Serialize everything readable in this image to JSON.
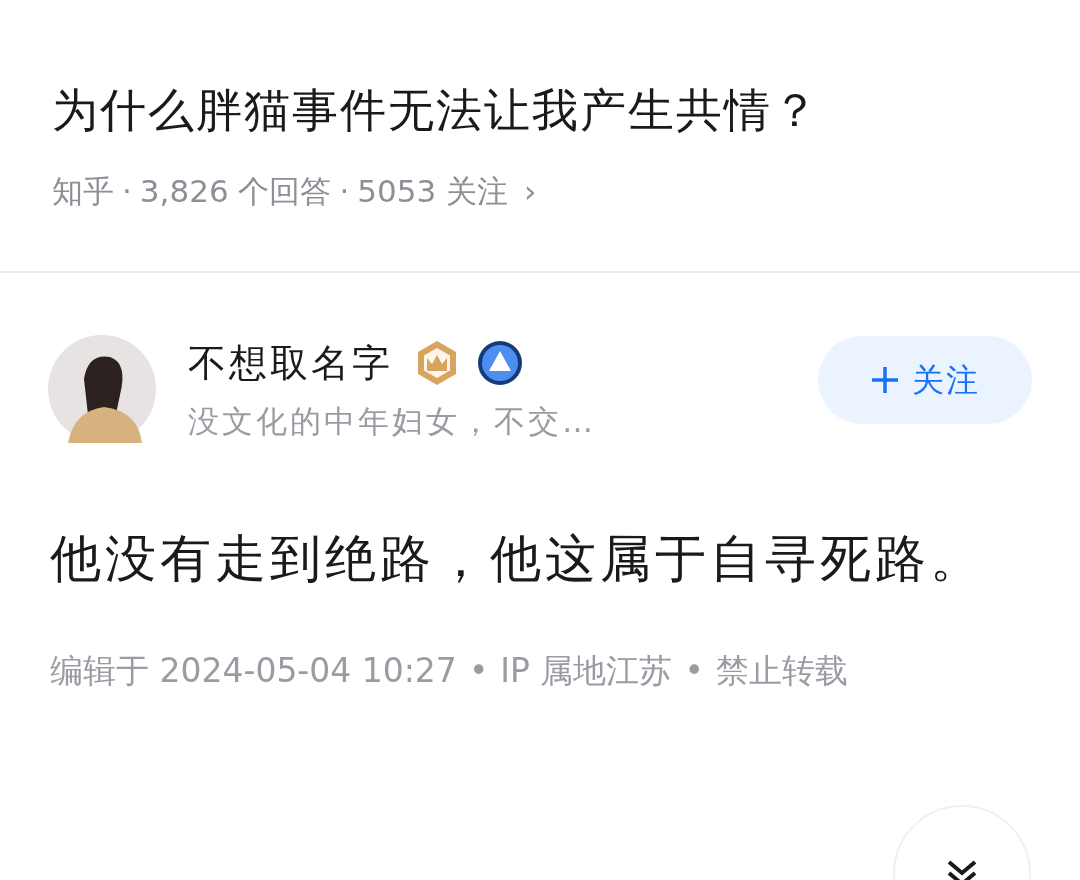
{
  "question": {
    "title": "为什么胖猫事件无法让我产生共情？",
    "meta": [
      "知乎",
      "3,826 个回答",
      "5053 关注"
    ],
    "separator": "·",
    "chevron": "›"
  },
  "author": {
    "name": "不想取名字",
    "bio": "没文化的中年妇女，不交…",
    "followed": false,
    "follow_label": "关注"
  },
  "answer": {
    "text": "他没有走到绝路，他这属于自寻死路。",
    "footer": [
      "编辑于 2024-05-04 10:27",
      "IP 属地江苏",
      "禁止转载"
    ],
    "separator": "•"
  }
}
